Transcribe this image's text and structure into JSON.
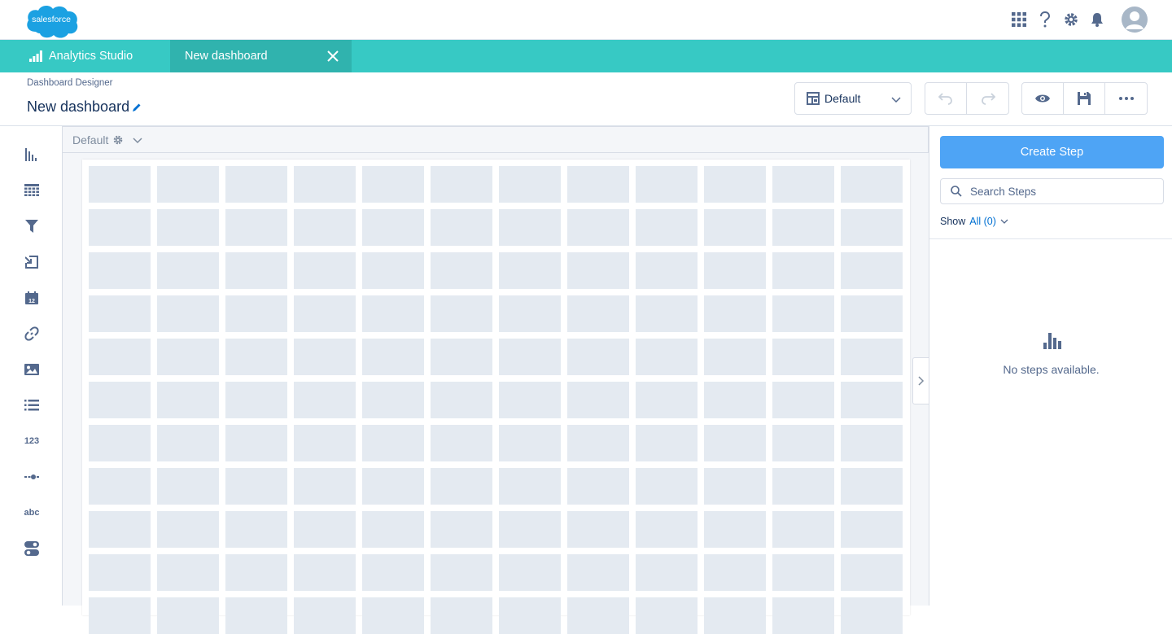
{
  "global_header": {
    "logo_text": "salesforce",
    "icons": [
      "app-launcher-icon",
      "help-icon",
      "setup-gear-icon",
      "notification-bell-icon",
      "user-avatar-icon"
    ]
  },
  "app_nav": {
    "app_name": "Analytics Studio",
    "active_tab": "New dashboard"
  },
  "page_header": {
    "subtitle": "Dashboard Designer",
    "title": "New dashboard",
    "layout_select": "Default"
  },
  "palette": {
    "items": [
      {
        "name": "chart-widget",
        "icon": "bar-chart-icon"
      },
      {
        "name": "table-widget",
        "icon": "table-icon"
      },
      {
        "name": "filter-widget",
        "icon": "filter-icon"
      },
      {
        "name": "toggle-widget",
        "icon": "list-selector-icon"
      },
      {
        "name": "date-widget",
        "icon": "calendar-icon",
        "text": "12"
      },
      {
        "name": "link-widget",
        "icon": "link-icon"
      },
      {
        "name": "image-widget",
        "icon": "image-icon"
      },
      {
        "name": "list-widget",
        "icon": "list-icon"
      },
      {
        "name": "number-widget",
        "icon": "number-icon",
        "text": "123"
      },
      {
        "name": "range-widget",
        "icon": "range-icon"
      },
      {
        "name": "text-widget",
        "icon": "text-icon",
        "text": "abc"
      },
      {
        "name": "toggle-switch-widget",
        "icon": "toggle-icon"
      }
    ]
  },
  "canvas": {
    "layout_label": "Default"
  },
  "right_panel": {
    "create_step_label": "Create Step",
    "search_placeholder": "Search Steps",
    "show_label": "Show",
    "show_value": "All (0)",
    "empty_message": "No steps available."
  },
  "colors": {
    "brand_teal": "#37c9c4",
    "active_tab": "#30b3ae",
    "primary_button": "#4ea4f5",
    "grid_cell": "#e4eaf1"
  }
}
